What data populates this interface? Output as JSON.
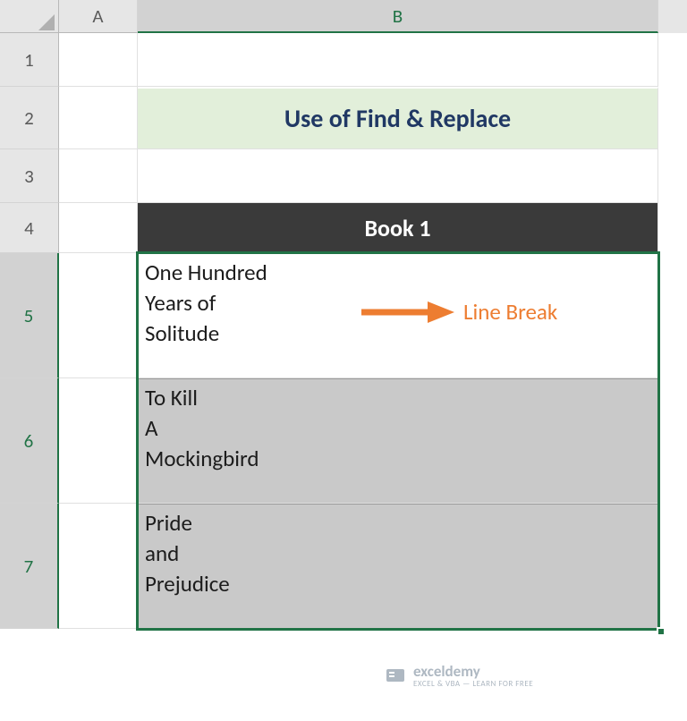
{
  "columns": {
    "A": "A",
    "B": "B"
  },
  "rows": {
    "1": "1",
    "2": "2",
    "3": "3",
    "4": "4",
    "5": "5",
    "6": "6",
    "7": "7"
  },
  "title": "Use of Find & Replace",
  "table": {
    "header": "Book 1",
    "rows": [
      "One Hundred\nYears of\nSolitude",
      "To Kill\nA\nMockingbird",
      "Pride\nand\nPrejudice"
    ]
  },
  "annotation": {
    "label": "Line Break"
  },
  "watermark": {
    "name": "exceldemy",
    "tagline": "EXCEL & VBA — LEARN FOR FREE"
  }
}
